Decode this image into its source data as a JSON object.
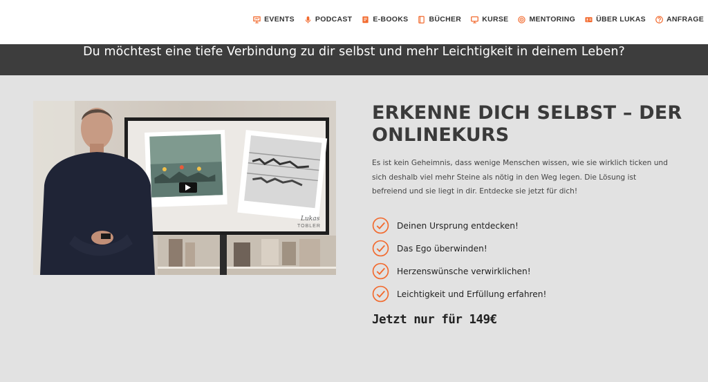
{
  "nav": {
    "items": [
      {
        "label": "EVENTS",
        "icon": "presentation-icon"
      },
      {
        "label": "PODCAST",
        "icon": "microphone-icon"
      },
      {
        "label": "E-BOOKS",
        "icon": "ebook-icon"
      },
      {
        "label": "BÜCHER",
        "icon": "book-icon"
      },
      {
        "label": "KURSE",
        "icon": "monitor-icon"
      },
      {
        "label": "MENTORING",
        "icon": "target-icon"
      },
      {
        "label": "ÜBER LUKAS",
        "icon": "id-card-icon"
      },
      {
        "label": "ANFRAGE",
        "icon": "question-icon"
      }
    ],
    "accent_color": "#f26a2e"
  },
  "banner": {
    "text": "Du möchtest eine tiefe Verbindung zu dir selbst und mehr Leichtigkeit in deinem Leben?"
  },
  "video": {
    "signature_line1": "Lukas",
    "signature_line2": "TOBLER"
  },
  "course": {
    "title": "ERKENNE DICH SELBST – DER ONLINEKURS",
    "description": "Es ist kein Geheimnis, dass wenige Menschen wissen, wie sie wirklich ticken und sich deshalb viel mehr Steine als nötig in den Weg legen. Die Lösung ist befreiend und sie liegt in dir. Entdecke sie jetzt für dich!",
    "benefits": [
      "Deinen Ursprung entdecken!",
      "Das Ego überwinden!",
      "Herzenswünsche verwirklichen!",
      "Leichtigkeit und Erfüllung erfahren!"
    ],
    "price": "Jetzt nur für 149€"
  }
}
